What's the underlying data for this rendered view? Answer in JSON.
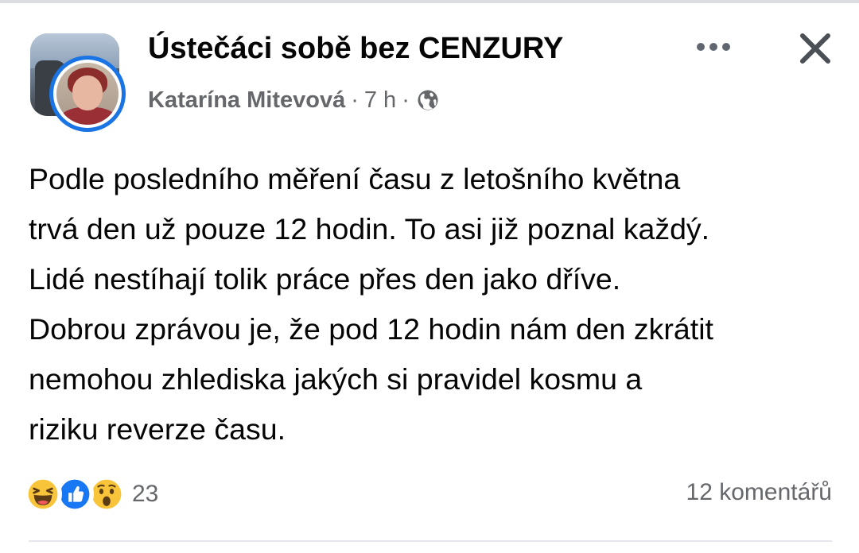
{
  "post": {
    "group_name": "Ústečáci sobě bez CENZURY",
    "author": "Katarína Mitevová",
    "time": "7 h",
    "separator": "·",
    "privacy_icon": "globe-icon",
    "menu_icon": "more-horizontal-icon",
    "close_icon": "close-icon",
    "body_lines": [
      "Podle posledního měření času z letošního května",
      "trvá den už pouze 12 hodin. To asi již poznal každý.",
      "Lidé nestíhají tolik práce přes den jako dříve.",
      "Dobrou zprávou je, že pod 12 hodin nám den zkrátit",
      "nemohou zhlediska jakých si pravidel kosmu a",
      "riziku reverze času."
    ],
    "reactions": {
      "icons": [
        "haha-icon",
        "like-icon",
        "wow-icon"
      ],
      "count": "23"
    },
    "comments_label": "12 komentářů"
  },
  "colors": {
    "accent_blue": "#1b74e4",
    "secondary_text": "#65676b",
    "reaction_yellow": "#f7c43a"
  }
}
